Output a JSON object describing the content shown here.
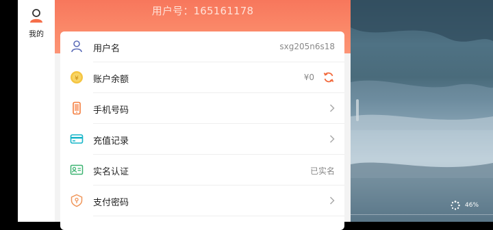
{
  "sidebar": {
    "me_label": "我的"
  },
  "header": {
    "account_id": "用户号：165161178"
  },
  "rows": [
    {
      "label": "用户名",
      "value": "sxg205n6s18",
      "icon": "user-icon"
    },
    {
      "label": "账户余额",
      "value": "¥0",
      "icon": "coin-icon"
    },
    {
      "label": "手机号码",
      "value": "",
      "icon": "phone-icon"
    },
    {
      "label": "充值记录",
      "value": "",
      "icon": "card-icon"
    },
    {
      "label": "实名认证",
      "value": "已实名",
      "icon": "id-card-icon"
    },
    {
      "label": "支付密码",
      "value": "",
      "icon": "shield-key-icon"
    }
  ],
  "video": {
    "percent": "46%"
  },
  "colors": {
    "header_start": "#f7775c",
    "header_end": "#fc9476",
    "accent": "#f26a3d"
  }
}
